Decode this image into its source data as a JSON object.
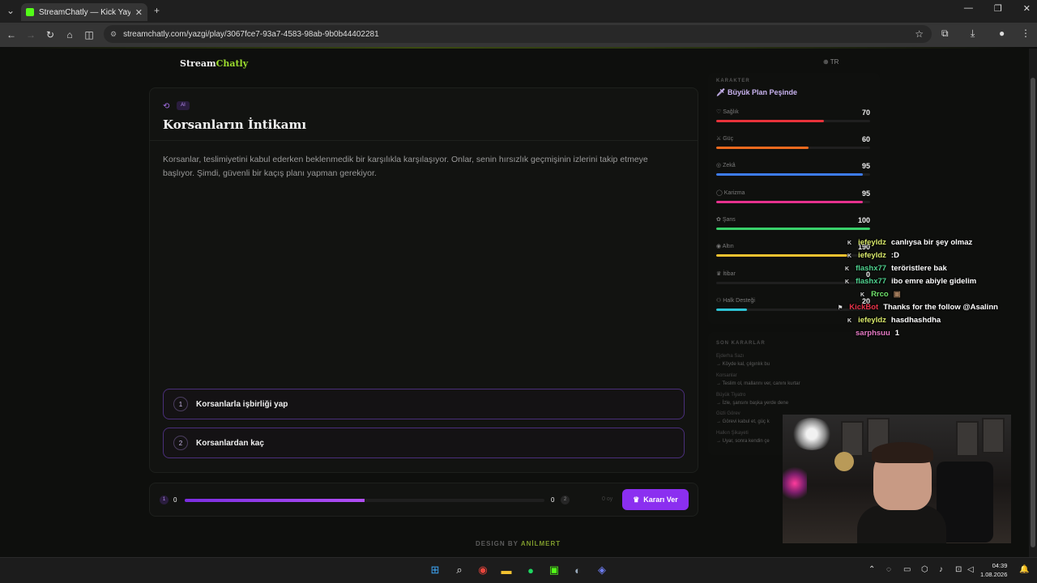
{
  "browser": {
    "tab_title": "StreamChatly — Kick Yayıncıları",
    "url": "streamchatly.com/yazgi/play/3067fce7-93a7-4583-98ab-9b0b44402281"
  },
  "header": {
    "logo_left": "Stream",
    "logo_right": "Chatly",
    "lang": "TR"
  },
  "story": {
    "badge": "AI",
    "title": "Korsanların İntikamı",
    "text": "Korsanlar, teslimiyetini kabul ederken beklenmedik bir karşılıkla karşılaşıyor. Onlar, senin hırsızlık geçmişinin izlerini takip etmeye başlıyor. Şimdi, güvenli bir kaçış planı yapman gerekiyor.",
    "choices": [
      {
        "num": "1",
        "label": "Korsanlarla işbirliği yap"
      },
      {
        "num": "2",
        "label": "Korsanlardan kaç"
      }
    ]
  },
  "vote": {
    "left_badge": "1",
    "left_count": "0",
    "right_count": "0",
    "right_badge": "2",
    "progress": 0.5,
    "timer": "0 oy",
    "decide_label": "Kararı Ver"
  },
  "footer": {
    "prefix": "DESIGN BY",
    "author": "ANİLMERT"
  },
  "character": {
    "label": "KARAKTER",
    "name": "Büyük Plan Peşinde",
    "stats": [
      {
        "label": "Sağlık",
        "value": "70",
        "fill": 0.7,
        "color": "#e8323a"
      },
      {
        "label": "Güç",
        "value": "60",
        "fill": 0.6,
        "color": "#f06a1e"
      },
      {
        "label": "Zekâ",
        "value": "95",
        "fill": 0.95,
        "color": "#3d7cf0"
      },
      {
        "label": "Karizma",
        "value": "95",
        "fill": 0.95,
        "color": "#e6318e"
      },
      {
        "label": "Şans",
        "value": "100",
        "fill": 1.0,
        "color": "#39d16a"
      },
      {
        "label": "Altın",
        "value": "190",
        "fill": 0.85,
        "color": "#f2c230"
      },
      {
        "label": "İtibar",
        "value": "0",
        "fill": 0.0,
        "color": "#8f4af0"
      },
      {
        "label": "Halk Desteği",
        "value": "20",
        "fill": 0.2,
        "color": "#2ec4d6"
      }
    ]
  },
  "decisions": {
    "label": "SON KARARLAR",
    "items": [
      {
        "title": "Ejderha Sazı",
        "action": "→ Köyde kal, çılgınlık bu"
      },
      {
        "title": "Korsanlar",
        "action": "→ Teslim ol, mallarını ver, canını kurtar"
      },
      {
        "title": "Büyük Tiyatro",
        "action": "→ İzle, şansını başka yerde dene"
      },
      {
        "title": "Gizli Görev",
        "action": "→ Görevi kabul et, güç k"
      },
      {
        "title": "Halkın Şikayeti",
        "action": "→ Uyar, sonra kendin çe"
      }
    ]
  },
  "chat": [
    {
      "user": "iefeyldz",
      "color": "#d8e86a",
      "message": "canlıysa bir şey olmaz"
    },
    {
      "user": "iefeyldz",
      "color": "#d8e86a",
      "message": ":D"
    },
    {
      "user": "flashx77",
      "color": "#4fd18e",
      "message": "teröristlere bak"
    },
    {
      "user": "flashx77",
      "color": "#4fd18e",
      "message": "ibo emre abiyle gidelim"
    },
    {
      "user": "Rrco",
      "color": "#6fe06a",
      "message": ""
    },
    {
      "user": "KickBot",
      "color": "#e8334a",
      "message": "Thanks for the follow @Asalinn"
    },
    {
      "user": "iefeyldz",
      "color": "#d8e86a",
      "message": "hasdhashdha"
    },
    {
      "user": "sarphsuu",
      "color": "#e57ac4",
      "message": "1"
    }
  ],
  "taskbar": {
    "time": "04:39",
    "date": "1.08.2026"
  }
}
